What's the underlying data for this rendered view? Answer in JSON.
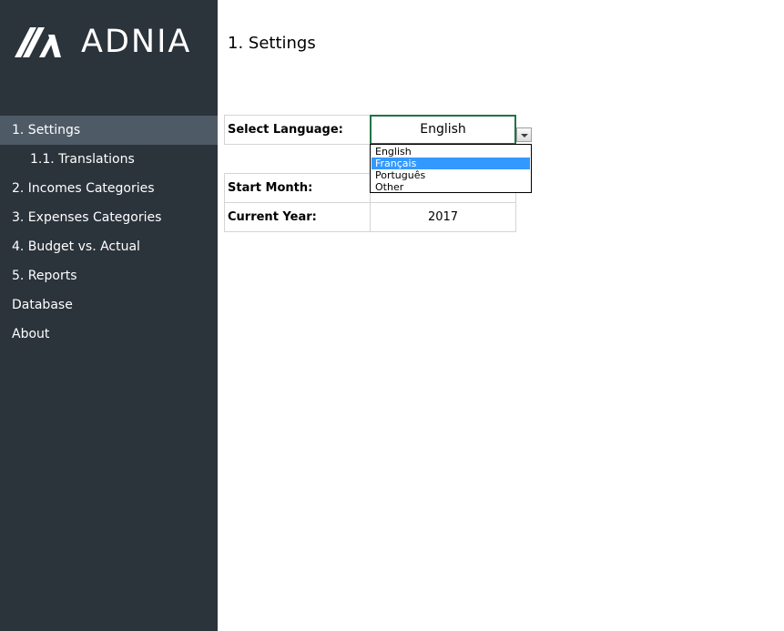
{
  "brand": {
    "logo_text": "ADNIA",
    "logo_icon": "adnia-logo-icon"
  },
  "sidebar": {
    "items": [
      {
        "label": "1. Settings",
        "active": true,
        "sub": false
      },
      {
        "label": "1.1. Translations",
        "active": false,
        "sub": true
      },
      {
        "label": "2. Incomes Categories",
        "active": false,
        "sub": false
      },
      {
        "label": "3. Expenses Categories",
        "active": false,
        "sub": false
      },
      {
        "label": "4. Budget vs. Actual",
        "active": false,
        "sub": false
      },
      {
        "label": "5. Reports",
        "active": false,
        "sub": false
      },
      {
        "label": "Database",
        "active": false,
        "sub": false
      },
      {
        "label": "About",
        "active": false,
        "sub": false
      }
    ]
  },
  "page": {
    "title": "1. Settings"
  },
  "settings": {
    "language_label": "Select Language:",
    "language_value": "English",
    "start_month_label": "Start Month:",
    "start_month_value": "",
    "current_year_label": "Current Year:",
    "current_year_value": "2017"
  },
  "language_dropdown": {
    "icon": "chevron-down-icon",
    "highlighted": "Français",
    "options": [
      "English",
      "Français",
      "Português",
      "Other"
    ]
  },
  "colors": {
    "sidebar_bg": "#2b333b",
    "sidebar_active": "#4e5a66",
    "selected_cell_border": "#217346",
    "dropdown_highlight": "#3399ff"
  }
}
